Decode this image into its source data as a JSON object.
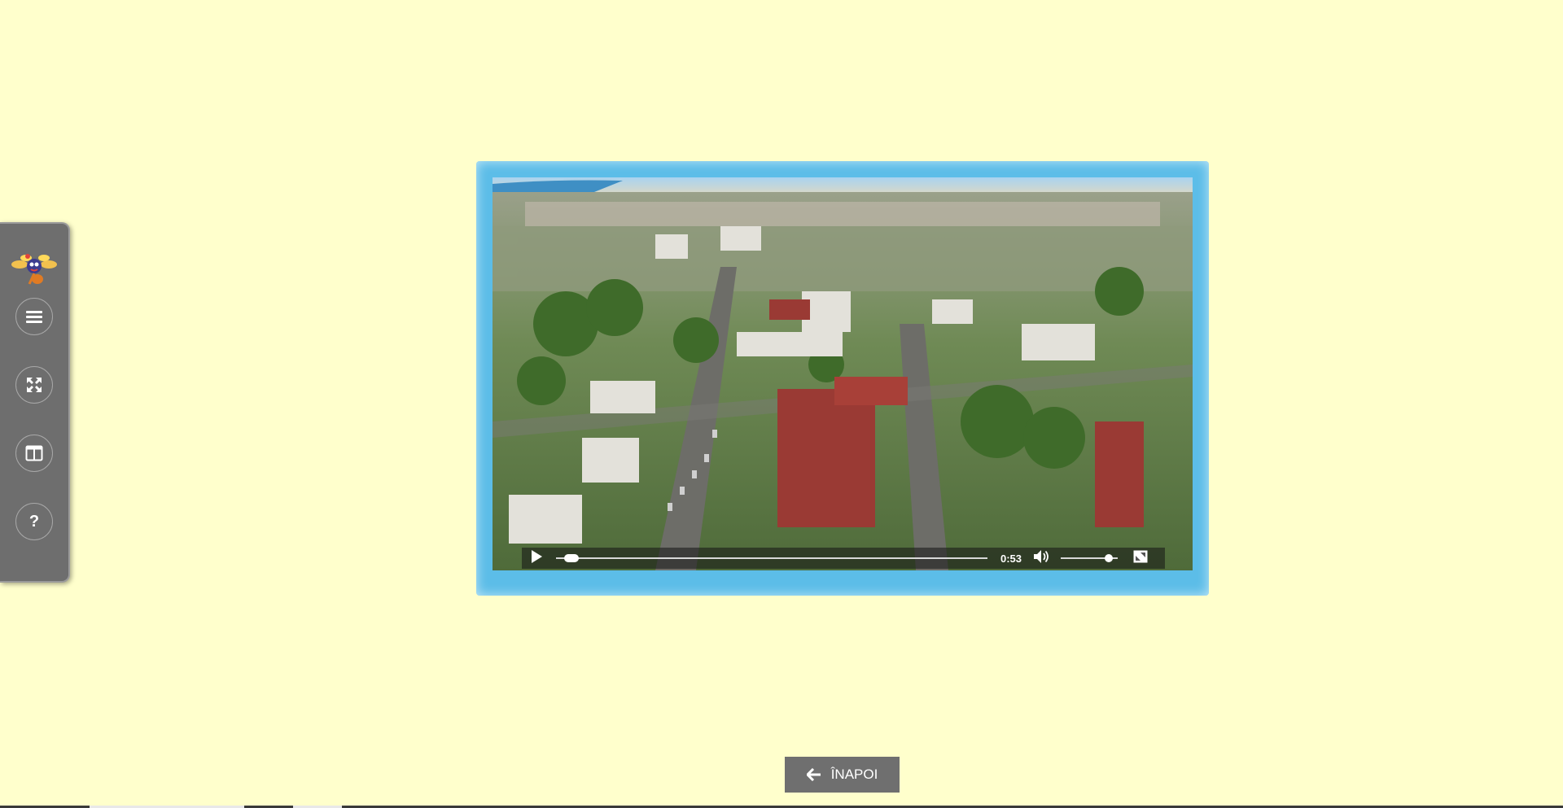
{
  "sidebar": {
    "logo": "bee-mascot-logo",
    "buttons": [
      {
        "name": "menu",
        "icon": "hamburger-menu-icon"
      },
      {
        "name": "fullscreen",
        "icon": "expand-arrows-icon"
      },
      {
        "name": "layout",
        "icon": "split-panel-icon"
      },
      {
        "name": "help",
        "icon": "question-icon",
        "label": "?"
      }
    ]
  },
  "video": {
    "content": "aerial-city-view",
    "progress_fraction": 0.02,
    "time": "0:53",
    "volume_fraction": 0.9
  },
  "back_button": {
    "label": "ÎNAPOI",
    "icon": "arrow-left-icon"
  },
  "colors": {
    "page_background": "#ffffcc",
    "sidebar_background": "#6e6e6e",
    "video_frame": "#5cbde8",
    "back_button": "#6f6f6f"
  }
}
